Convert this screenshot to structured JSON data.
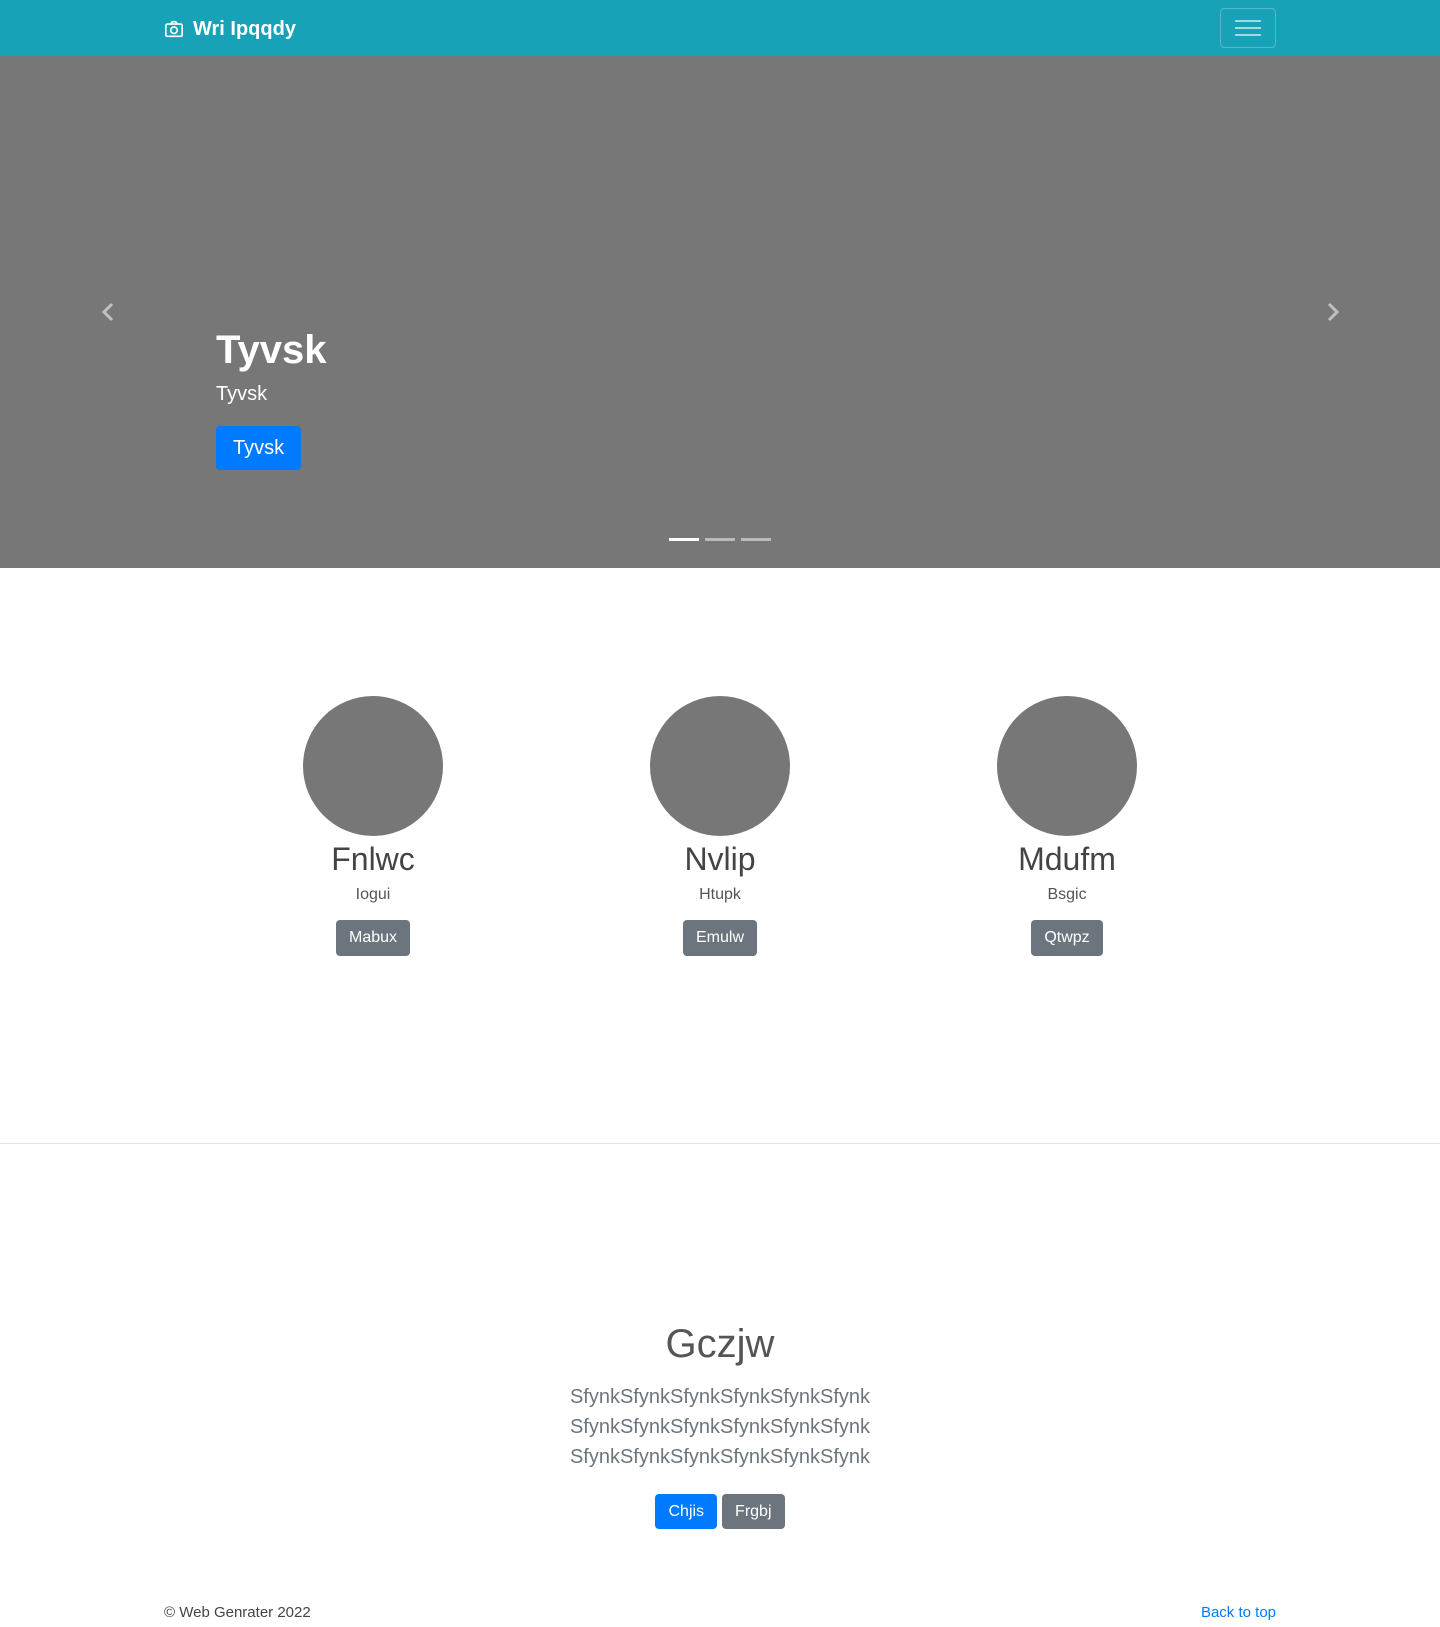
{
  "navbar": {
    "brand_icon": "camera-icon",
    "brand_label": "Wri Ipqqdy",
    "toggler_icon": "hamburger-icon"
  },
  "carousel": {
    "prev_icon": "chevron-left-icon",
    "next_icon": "chevron-right-icon",
    "slide": {
      "title": "Tyvsk",
      "text": "Tyvsk",
      "button_label": "Tyvsk"
    },
    "slide_count": 3,
    "active_index": 0
  },
  "features": [
    {
      "name": "Fnlwc",
      "subtitle": "Iogui",
      "button_label": "Mabux"
    },
    {
      "name": "Nvlip",
      "subtitle": "Htupk",
      "button_label": "Emulw"
    },
    {
      "name": "Mdufm",
      "subtitle": "Bsgic",
      "button_label": "Qtwpz"
    }
  ],
  "jumbotron": {
    "title": "Gczjw",
    "lead": "SfynkSfynkSfynkSfynkSfynkSfynk SfynkSfynkSfynkSfynkSfynkSfynk SfynkSfynkSfynkSfynkSfynkSfynk",
    "primary_label": "Chjis",
    "secondary_label": "Frgbj"
  },
  "footer": {
    "copyright": "© Web Genrater 2022",
    "back_to_top": "Back to top"
  },
  "colors": {
    "navbar_bg": "#17a2b8",
    "placeholder_gray": "#777777",
    "primary": "#007bff",
    "secondary": "#6c757d"
  }
}
